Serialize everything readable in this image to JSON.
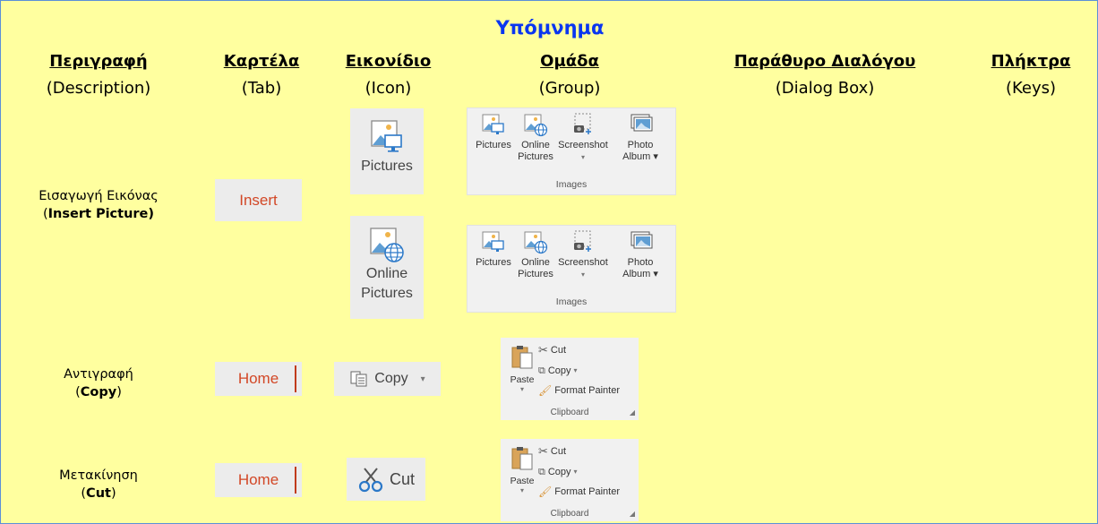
{
  "title": "Υπόμνημα",
  "columns": [
    {
      "heading": "Περιγραφή",
      "sub": "(Description)"
    },
    {
      "heading": "Καρτέλα",
      "sub": "(Tab)"
    },
    {
      "heading": "Εικονίδιο",
      "sub": "(Icon)"
    },
    {
      "heading": "Ομάδα",
      "sub": "(Group)"
    },
    {
      "heading": "Παράθυρο Διαλόγου",
      "sub": "(Dialog Box)"
    },
    {
      "heading": "Πλήκτρα",
      "sub": "(Keys)"
    }
  ],
  "rows": {
    "insert_picture": {
      "desc_gr": "Εισαγωγή Εικόνας",
      "desc_en_open": "(",
      "desc_en_bold": "Insert Picture)",
      "desc_en_close": "",
      "tab": "Insert",
      "icon1": [
        "Pictures"
      ],
      "icon2": [
        "Online",
        "Pictures"
      ]
    },
    "copy": {
      "desc_gr": "Αντιγραφή",
      "desc_en_open": "(",
      "desc_en_bold": "Copy",
      "desc_en_close": ")",
      "tab": "Home",
      "icon": "Copy"
    },
    "cut": {
      "desc_gr": "Μετακίνηση",
      "desc_en_open": "(",
      "desc_en_bold": "Cut",
      "desc_en_close": ")",
      "tab": "Home",
      "icon": "Cut"
    }
  },
  "images_group": {
    "items": [
      {
        "l1": "Pictures",
        "l2": ""
      },
      {
        "l1": "Online",
        "l2": "Pictures"
      },
      {
        "l1": "Screenshot",
        "l2": "▾"
      },
      {
        "l1": "Photo",
        "l2": "Album ▾"
      }
    ],
    "group_label": "Images"
  },
  "clipboard_group": {
    "paste": "Paste",
    "cut": "Cut",
    "copy": "Copy",
    "format_painter": "Format Painter",
    "group_label": "Clipboard"
  },
  "colors": {
    "title": "#0a36f0",
    "background": "#ffff9f",
    "border": "#5b8fd8",
    "tab_text": "#d24726"
  }
}
